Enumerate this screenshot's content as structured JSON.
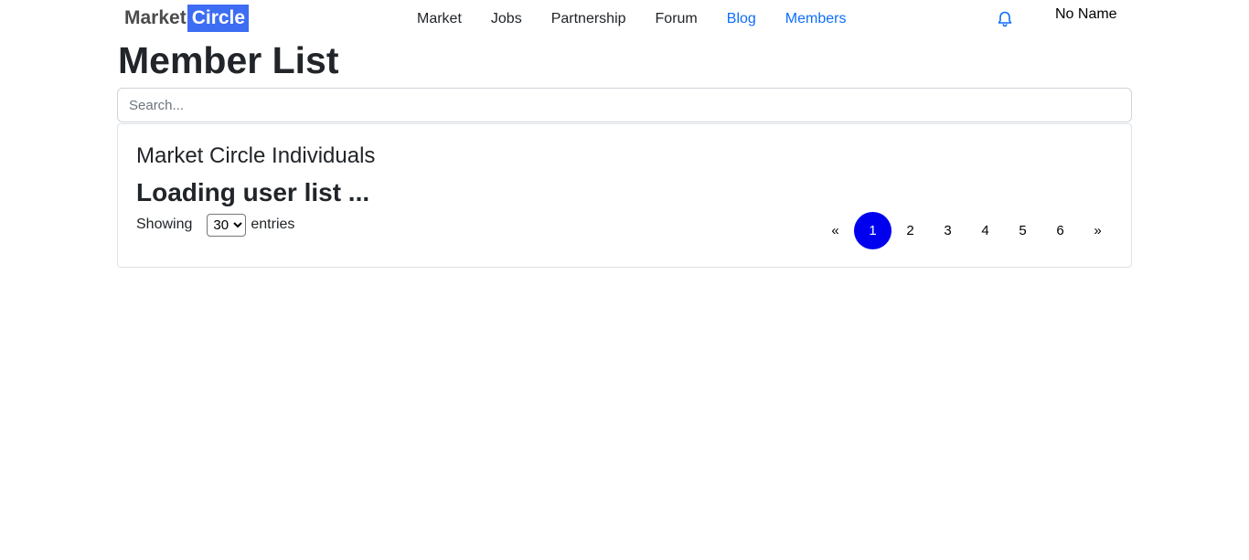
{
  "navbar": {
    "logo": {
      "part1": "Market",
      "part2": "Circle"
    },
    "links": [
      {
        "label": "Market"
      },
      {
        "label": "Jobs"
      },
      {
        "label": "Partnership"
      },
      {
        "label": "Forum"
      },
      {
        "label": "Blog"
      },
      {
        "label": "Members"
      }
    ],
    "notification_icon": "bell-icon",
    "username": "No Name"
  },
  "page": {
    "title": "Member List"
  },
  "search": {
    "placeholder": "Search..."
  },
  "card": {
    "title": "Market Circle Individuals",
    "loading_text": "Loading user list ...",
    "entries": {
      "prefix": "Showing",
      "selected": "30",
      "suffix": "entries"
    },
    "pagination": {
      "prev": "«",
      "pages": [
        "1",
        "2",
        "3",
        "4",
        "5",
        "6"
      ],
      "active_page": "1",
      "next": "»"
    }
  },
  "colors": {
    "brand_blue": "#3d6df2",
    "link_blue": "#0d6efd",
    "active_page": "#0000ee"
  }
}
